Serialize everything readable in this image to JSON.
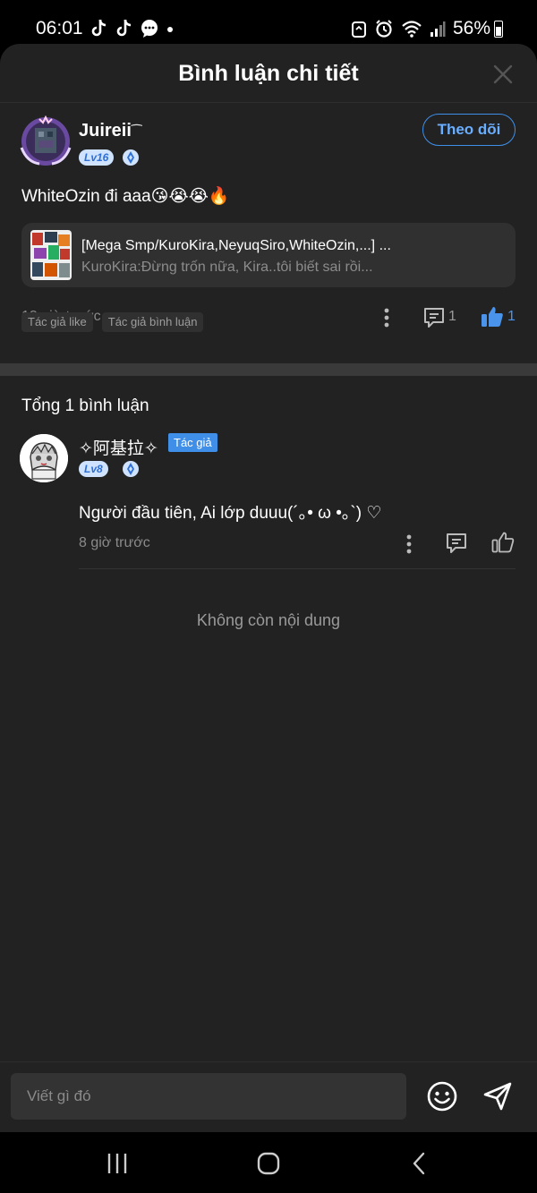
{
  "status_bar": {
    "time": "06:01",
    "battery": "56%",
    "battery_level": 0.56
  },
  "header": {
    "title": "Bình luận chi tiết"
  },
  "main_comment": {
    "username": "Juireii",
    "level": "Lv16",
    "follow_label": "Theo dõi",
    "text": "WhiteOzin đi aaa😘😭😭🔥",
    "ref_title": "[Mega Smp/KuroKira,NeyuqSiro,WhiteOzin,...] ...",
    "ref_subtitle": "KuroKira:Đừng trốn nữa, Kira..tôi biết sai rồi...",
    "time": "13 giờ trước",
    "reply_count": "1",
    "like_count": "1",
    "tags": [
      "Tác giả like",
      "Tác giả bình luận"
    ]
  },
  "replies_section": {
    "total_label": "Tổng 1 bình luận",
    "no_more": "Không còn nội dung"
  },
  "reply": {
    "username": "✧阿基拉✧",
    "author_badge": "Tác giả",
    "level": "Lv8",
    "text": "Người đầu tiên, Ai lớp duuu(´｡• ω •｡`) ♡",
    "time": "8 giờ trước"
  },
  "input": {
    "placeholder": "Viết gì đó"
  },
  "colors": {
    "accent": "#3f8fe8",
    "sheet_bg": "#222222",
    "like_active": "#4a94ec"
  }
}
